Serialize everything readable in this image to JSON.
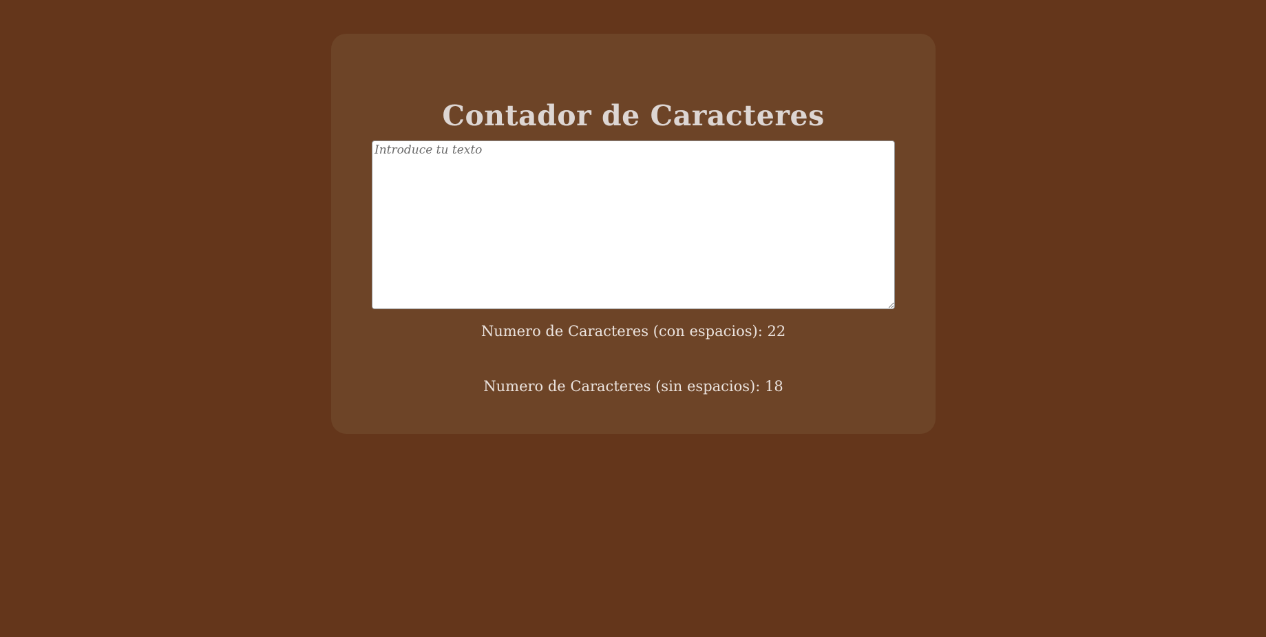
{
  "colors": {
    "background": "#64361b",
    "card": "#6d4427",
    "text": "#ebe3de",
    "textarea": "#ffffff"
  },
  "card": {
    "title": "Contador de Caracteres",
    "input": {
      "placeholder": "Introduce tu texto",
      "value": ""
    },
    "counts": {
      "with_spaces_label": "Numero de Caracteres (con espacios): 22",
      "without_spaces_label": "Numero de Caracteres (sin espacios): 18",
      "with_spaces": 22,
      "without_spaces": 18
    }
  }
}
